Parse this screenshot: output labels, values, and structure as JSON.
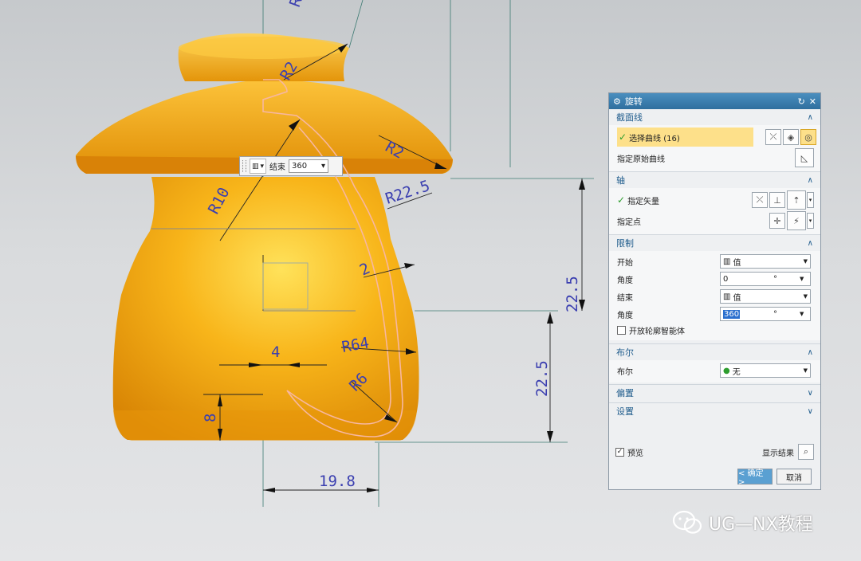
{
  "viewport": {
    "dimensions": {
      "r_top": "R",
      "r2_top": "R2",
      "r2_rim": "R2",
      "r22_5": "R22.5",
      "r10": "R10",
      "two": "2",
      "r64": "R64",
      "four": "4",
      "r6": "R6",
      "eight": "8",
      "v22_5_upper": "22.5",
      "v22_5_lower": "22.5",
      "w19_8": "19.8"
    },
    "mini_toolbar": {
      "end_label": "结束",
      "end_value": "360"
    }
  },
  "dialog": {
    "title": "旋转",
    "sections": {
      "section_curve": {
        "title": "截面线",
        "select_curve": "选择曲线 (16)",
        "specify_original": "指定原始曲线"
      },
      "axis": {
        "title": "轴",
        "specify_vector": "指定矢量",
        "specify_point": "指定点"
      },
      "limits": {
        "title": "限制",
        "start_label": "开始",
        "start_value": "值",
        "start_angle_label": "角度",
        "start_angle_value": "0",
        "end_label": "结束",
        "end_value": "值",
        "end_angle_label": "角度",
        "end_angle_value": "360",
        "degree_unit": "°",
        "open_profile": "开放轮廓智能体"
      },
      "boolean": {
        "title": "布尔",
        "label": "布尔",
        "value": "无"
      },
      "offset": {
        "title": "偏置"
      },
      "settings": {
        "title": "设置"
      }
    },
    "footer": {
      "preview": "预览",
      "show_result": "显示结果",
      "ok": "< 确定 >",
      "cancel": "取消"
    }
  },
  "watermark": "UG—NX教程",
  "colors": {
    "part_orange": "#f6a60f",
    "title_blue": "#3a7fb0",
    "highlight_yellow": "#fde08a",
    "dim_blue": "#3b3fb0"
  }
}
